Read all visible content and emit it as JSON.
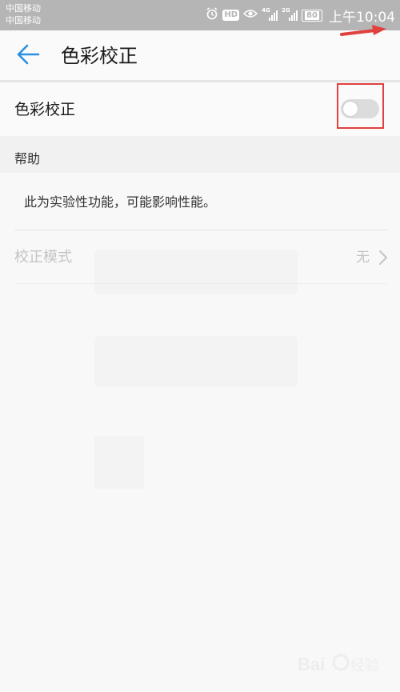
{
  "status_bar": {
    "carrier_1": "中国移动",
    "carrier_2": "中国移动",
    "hd_label": "HD",
    "network_1": "4G",
    "network_2": "2G",
    "battery": "80",
    "time": "上午10:04",
    "icons": [
      "alarm-icon",
      "hd-icon",
      "eye-icon",
      "signal-icon",
      "signal-icon",
      "battery-icon"
    ]
  },
  "header": {
    "title": "色彩校正",
    "back_icon": "back-arrow-icon"
  },
  "annotation": {
    "arrow_color": "#e0413f",
    "highlight_color": "#e0413f"
  },
  "toggle": {
    "label": "色彩校正",
    "state": "off",
    "track_color": "#dcdcdc"
  },
  "help": {
    "header": "帮助",
    "text": "此为实验性功能，可能影响性能。"
  },
  "mode": {
    "label": "校正模式",
    "value": "无",
    "chevron_icon": "chevron-right-icon",
    "enabled": false
  },
  "colors": {
    "accent": "#2a8fe0",
    "status_bar": "#b5b5b5",
    "disabled_text": "#c4c4c4"
  }
}
